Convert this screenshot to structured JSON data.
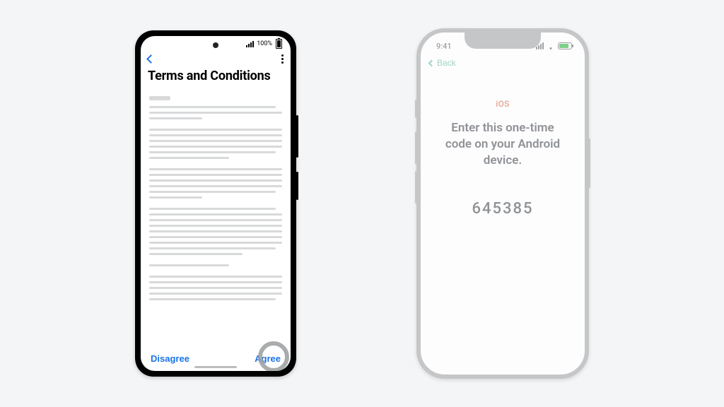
{
  "android": {
    "status": {
      "battery_text": "100%"
    },
    "title": "Terms and Conditions",
    "disagree_label": "Disagree",
    "agree_label": "Agree"
  },
  "iphone": {
    "status": {
      "time": "9:41"
    },
    "back_label": "Back",
    "platform_label": "iOS",
    "message": "Enter this one-time code on your Android device.",
    "code": "645385"
  }
}
